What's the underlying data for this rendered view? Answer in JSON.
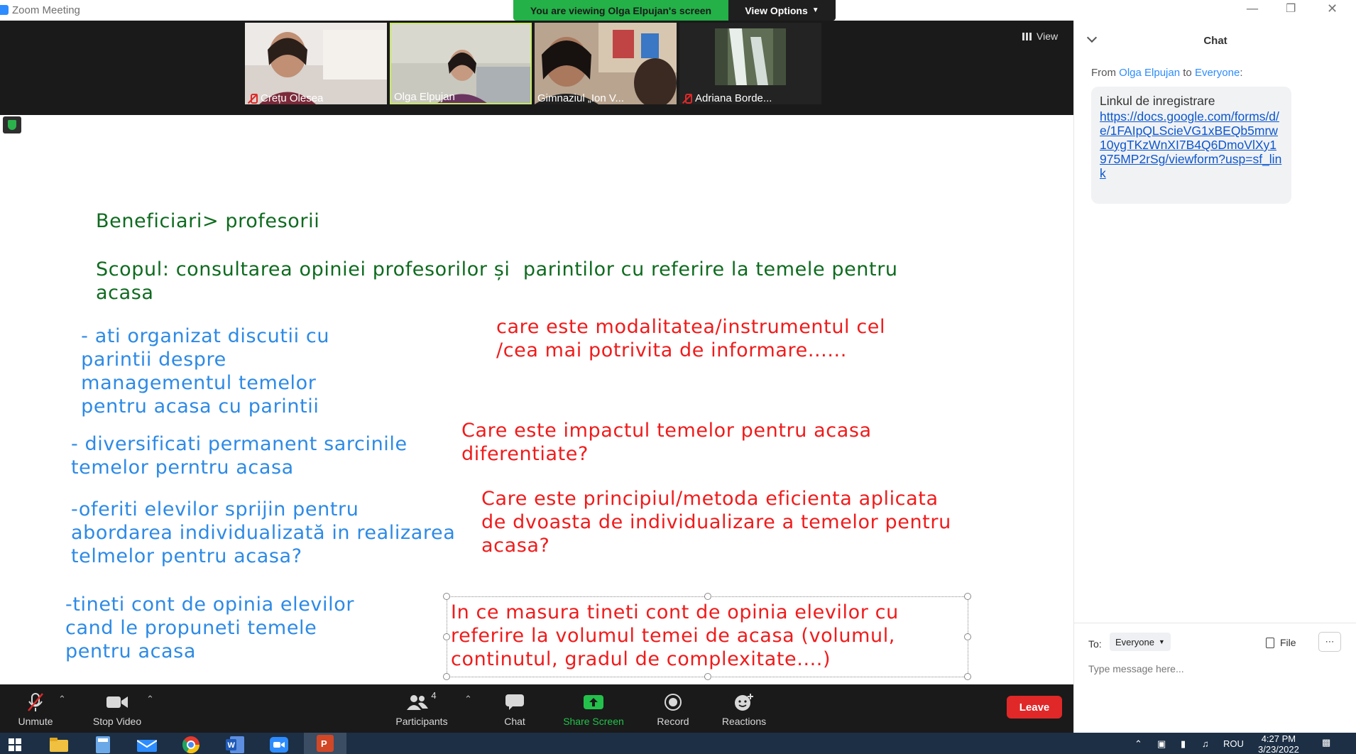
{
  "window": {
    "title": "Zoom Meeting",
    "viewing_banner": "You are viewing Olga Elpujan's screen",
    "view_options": "View Options"
  },
  "participants_strip": {
    "tiles": [
      {
        "name": "Crețu Olesea",
        "muted": true
      },
      {
        "name": "Olga Elpujan",
        "muted": false
      },
      {
        "name": "Gimnaziul „Ion V...",
        "muted": false
      },
      {
        "name": "Adriana Borde...",
        "muted": true
      }
    ],
    "view_label": "View"
  },
  "slide": {
    "heading": "Beneficiari> profesorii",
    "scope": "Scopul: consultarea opiniei profesorilor și  parintilor cu referire la temele pentru\nacasa",
    "left_items": [
      " - ati organizat discutii cu\n parintii despre\n managementul temelor\n pentru acasa cu parintii",
      "- diversificati permanent sarcinile\ntemelor perntru acasa",
      "-oferiti elevilor sprijin pentru\nabordarea individualizată in realizarea\ntelmelor pentru acasa?",
      "-tineti cont de opinia elevilor\ncand le propuneti temele\npentru acasa"
    ],
    "right_items": [
      "care este modalitatea/instrumentul cel\n/cea mai potrivita de informare......",
      "Care este impactul temelor pentru acasa\ndiferentiate?",
      "Care este principiul/metoda eficienta aplicata\nde dvoasta de individualizare a temelor pentru\nacasa?",
      "In ce masura tineti cont de opinia elevilor cu\nreferire la volumul temei de acasa (volumul,\ncontinutul, gradul de complexitate....)"
    ]
  },
  "toolbar": {
    "unmute": "Unmute",
    "stop_video": "Stop Video",
    "participants": "Participants",
    "participants_count": "4",
    "chat": "Chat",
    "share_screen": "Share Screen",
    "record": "Record",
    "reactions": "Reactions",
    "leave": "Leave"
  },
  "chat": {
    "title": "Chat",
    "from_prefix": "From ",
    "from_name": "Olga Elpujan",
    "to_word": " to ",
    "to_name": "Everyone",
    "colon": ":",
    "message_text": "Linkul de inregistrare",
    "message_link": "https://docs.google.com/forms/d/e/1FAIpQLScieVG1xBEQb5mrw10ygTKzWnXI7B4Q6DmoVlXy1975MP2rSg/viewform?usp=sf_link",
    "to_label": "To:",
    "to_value": "Everyone",
    "file": "File",
    "placeholder": "Type message here..."
  },
  "taskbar": {
    "time": "4:27 PM",
    "date": "3/23/2022",
    "lang": "ROU"
  },
  "colors": {
    "green_banner": "#23b148",
    "leave_red": "#e02828",
    "share_green": "#23c14b",
    "zoom_blue": "#2d8cff",
    "slide_green": "#0e6b1f",
    "slide_blue": "#2d8ae6",
    "slide_red": "#f01b1b"
  }
}
